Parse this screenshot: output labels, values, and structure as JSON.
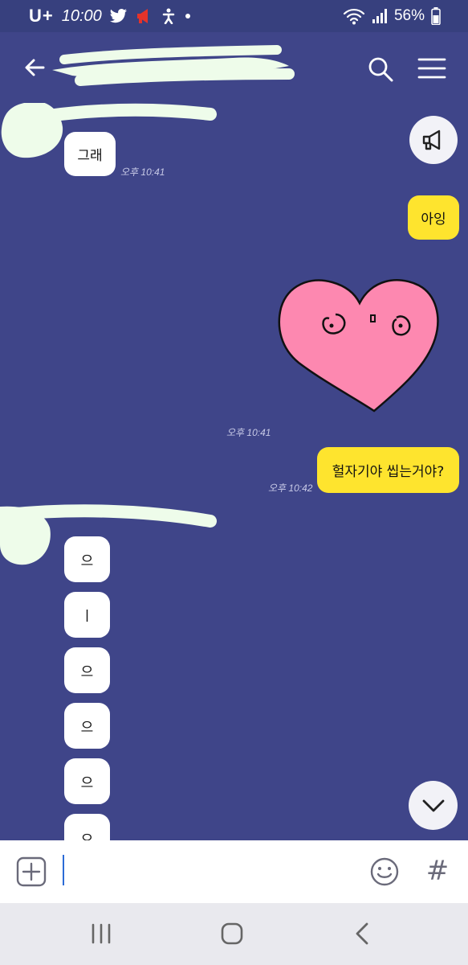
{
  "status_bar": {
    "carrier": "U+",
    "time": "10:00",
    "battery": "56%"
  },
  "header": {
    "back_icon": "arrow-left-icon",
    "search_icon": "search-icon",
    "menu_icon": "hamburger-menu-icon"
  },
  "messages": [
    {
      "side": "left",
      "text": "그래",
      "time": "오후 10:41"
    },
    {
      "side": "right",
      "text": "아잉"
    },
    {
      "side": "right",
      "type": "sticker",
      "sticker": "pink-heart",
      "time": "오후 10:41"
    },
    {
      "side": "right",
      "text": "헐자기야 씹는거야?",
      "time": "오후 10:42"
    },
    {
      "side": "left",
      "text": "으"
    },
    {
      "side": "left",
      "text": "ㅣ"
    },
    {
      "side": "left",
      "text": "으"
    },
    {
      "side": "left",
      "text": "으"
    },
    {
      "side": "left",
      "text": "으"
    },
    {
      "side": "left",
      "text": "으"
    }
  ],
  "colors": {
    "chat_background": "#3f4589",
    "status_bar": "#37407e",
    "my_bubble": "#fee42e",
    "their_bubble": "#ffffff",
    "sticker_heart": "#fd88b0"
  },
  "input": {
    "value": "",
    "add_icon": "plus-box-icon",
    "emoji_icon": "emoji-icon",
    "hash_label": "#"
  },
  "nav": {
    "recents_icon": "recents-icon",
    "home_icon": "home-icon",
    "back_icon": "nav-back-icon"
  }
}
